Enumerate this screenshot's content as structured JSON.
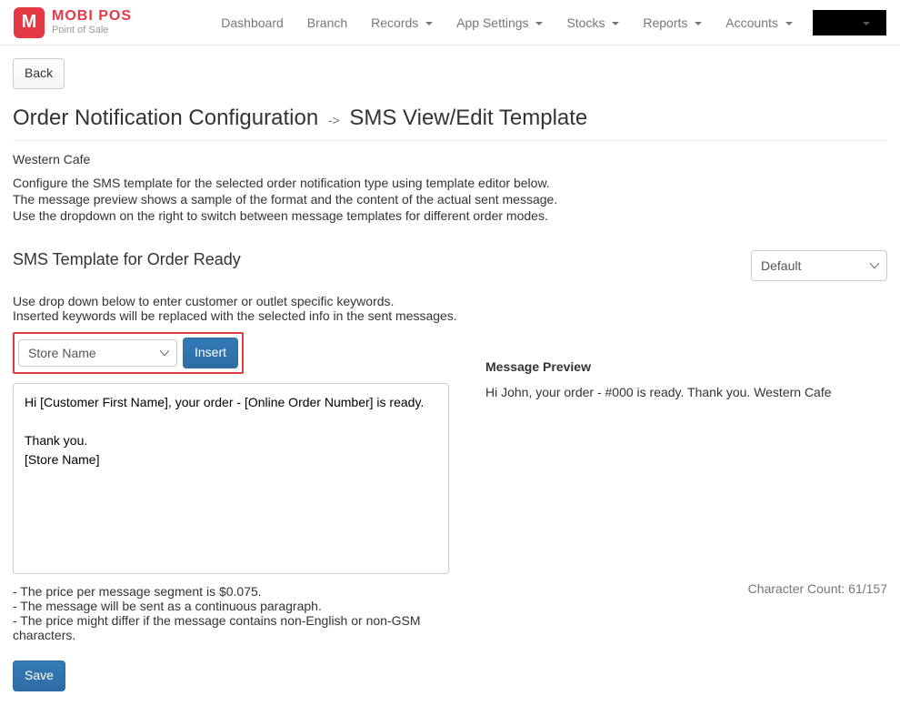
{
  "logo": {
    "brand": "MOBI POS",
    "subtitle": "Point of Sale",
    "glyph": "M"
  },
  "nav": {
    "items": [
      {
        "label": "Dashboard",
        "dropdown": false
      },
      {
        "label": "Branch",
        "dropdown": false
      },
      {
        "label": "Records",
        "dropdown": true
      },
      {
        "label": "App Settings",
        "dropdown": true
      },
      {
        "label": "Stocks",
        "dropdown": true
      },
      {
        "label": "Reports",
        "dropdown": true
      },
      {
        "label": "Accounts",
        "dropdown": true
      }
    ]
  },
  "back_label": "Back",
  "page_title": {
    "main": "Order Notification Configuration",
    "arrow": "->",
    "sub": "SMS View/Edit Template"
  },
  "outlet_name": "Western Cafe",
  "description": [
    "Configure the SMS template for the selected order notification type using template editor below.",
    "The message preview shows a sample of the format and the content of the actual sent message.",
    "Use the dropdown on the right to switch between message templates for different order modes."
  ],
  "section_title": "SMS Template for Order Ready",
  "mode_select_value": "Default",
  "instructions": [
    "Use drop down below to enter customer or outlet specific keywords.",
    "Inserted keywords will be replaced with the selected info in the sent messages."
  ],
  "keyword_select_value": "Store Name",
  "insert_label": "Insert",
  "template_value": "Hi [Customer First Name], your order - [Online Order Number] is ready.\n\nThank you.\n[Store Name]",
  "preview_title": "Message Preview",
  "preview_text": "Hi John, your order - #000 is ready. Thank you. Western Cafe",
  "notes": [
    "- The price per message segment is $0.075.",
    "- The message will be sent as a continuous paragraph.",
    "- The price might differ if the message contains non-English or non-GSM characters."
  ],
  "char_count": "Character Count: 61/157",
  "save_label": "Save"
}
